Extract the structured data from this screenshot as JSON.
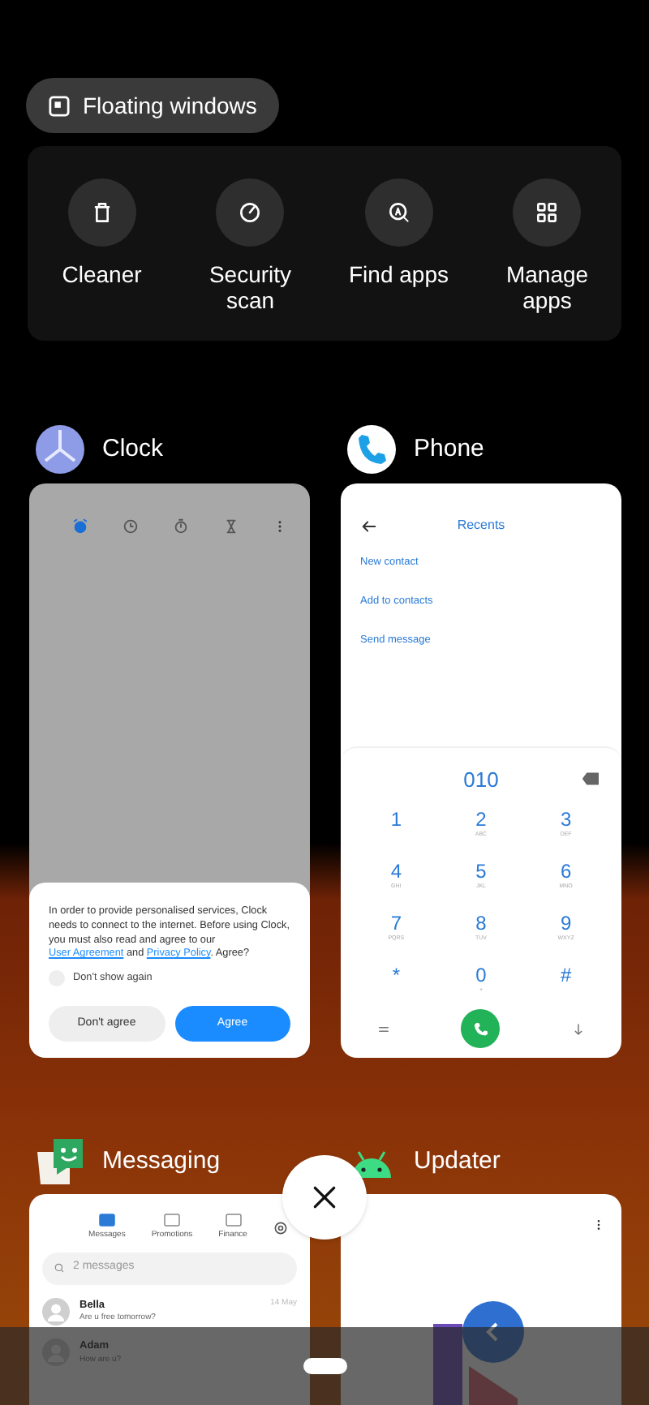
{
  "floating_windows": {
    "label": "Floating windows"
  },
  "quick_actions": [
    {
      "kind": "cleaner",
      "label": "Cleaner"
    },
    {
      "kind": "security",
      "label": "Security scan"
    },
    {
      "kind": "find",
      "label": "Find apps"
    },
    {
      "kind": "manage",
      "label": "Manage apps"
    }
  ],
  "apps": [
    {
      "kind": "clock",
      "name": "Clock",
      "tabs": [
        {
          "kind": "alarm",
          "selected": true
        },
        {
          "kind": "clock",
          "selected": false
        },
        {
          "kind": "stopwatch",
          "selected": false
        },
        {
          "kind": "timer",
          "selected": false
        }
      ],
      "dialog": {
        "message": [
          {
            "kind": "text",
            "text": "In order to provide personalised services, Clock needs to connect to the internet. Before using Clock, you must also read and agree to our "
          },
          {
            "kind": "link",
            "text": "User Agreement"
          },
          {
            "kind": "text",
            "text": " and "
          },
          {
            "kind": "link",
            "text": "Privacy Policy"
          },
          {
            "kind": "text",
            "text": ". Agree?"
          }
        ],
        "checkbox": {
          "label": "Don't show again",
          "checked": false
        },
        "buttons": [
          {
            "kind": "secondary",
            "label": "Don't agree"
          },
          {
            "kind": "primary",
            "label": "Agree"
          }
        ]
      }
    },
    {
      "kind": "phone",
      "name": "Phone",
      "title": "Recents",
      "actions": [
        "New contact",
        "Add to contacts",
        "Send message"
      ],
      "number": "010",
      "keys": [
        {
          "digit": "1"
        },
        {
          "digit": "2",
          "letters": "ABC"
        },
        {
          "digit": "3",
          "letters": "DEF"
        },
        {
          "digit": "4",
          "letters": "GHI"
        },
        {
          "digit": "5",
          "letters": "JKL"
        },
        {
          "digit": "6",
          "letters": "MNO"
        },
        {
          "digit": "7",
          "letters": "PQRS"
        },
        {
          "digit": "8",
          "letters": "TUV"
        },
        {
          "digit": "9",
          "letters": "WXYZ"
        },
        {
          "digit": "*"
        },
        {
          "digit": "0",
          "letters": "+"
        },
        {
          "digit": "#"
        }
      ]
    },
    {
      "kind": "messaging",
      "name": "Messaging",
      "tabs": [
        {
          "label": "Messages",
          "selected": true
        },
        {
          "label": "Promotions",
          "selected": false
        },
        {
          "label": "Finance",
          "selected": false
        }
      ],
      "search": {
        "placeholder": "2 messages"
      },
      "conversations": [
        {
          "name": "Bella",
          "preview": "Are u free tomorrow?",
          "date": "14 May"
        },
        {
          "name": "Adam",
          "preview": "How are u?"
        }
      ]
    },
    {
      "kind": "updater",
      "name": "Updater"
    }
  ]
}
